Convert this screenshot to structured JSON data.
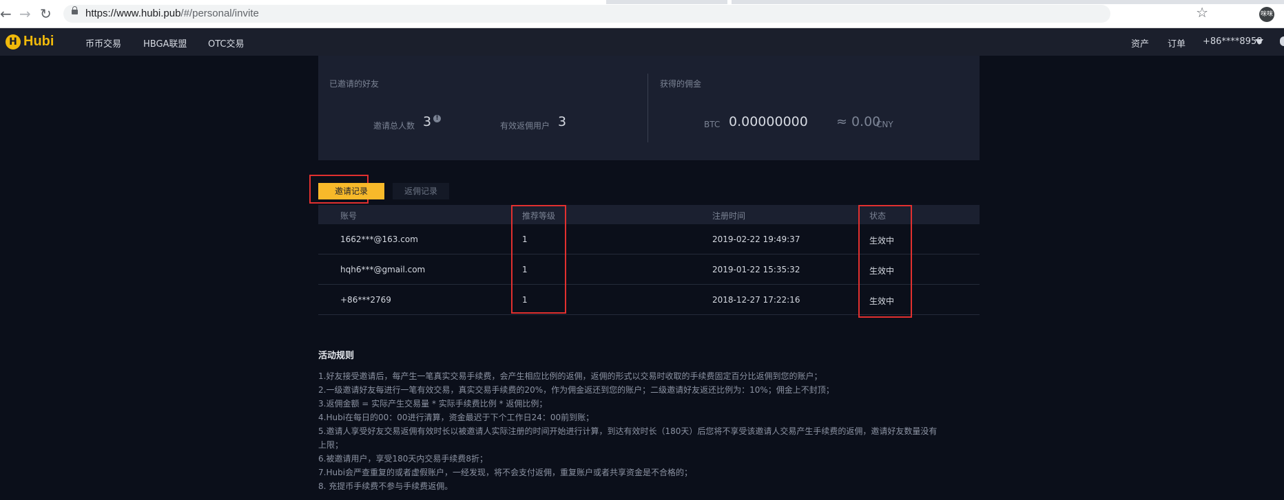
{
  "browser": {
    "url_host": "https://www.hubi.pub",
    "url_path": "/#/personal/invite",
    "profile_label": "咪咪"
  },
  "header": {
    "logo_mark": "H",
    "logo_text": "Hubi",
    "nav": [
      "币币交易",
      "HBGA联盟",
      "OTC交易"
    ],
    "right": [
      "资产",
      "订单",
      "+86****8958"
    ]
  },
  "stats": {
    "invited_title": "已邀请的好友",
    "total_label": "邀请总人数",
    "total_value": "3",
    "info_glyph": "!",
    "valid_label": "有效返佣用户",
    "valid_value": "3",
    "commission_title": "获得的佣金",
    "btc_label": "BTC",
    "btc_value": "0.00000000",
    "cny_value": "≈ 0.00",
    "cny_label": "CNY"
  },
  "tabs": {
    "active": "邀请记录",
    "inactive": "返佣记录"
  },
  "table": {
    "headers": [
      "账号",
      "推荐等级",
      "注册时间",
      "状态"
    ],
    "rows": [
      {
        "account": "1662***@163.com",
        "level": "1",
        "time": "2019-02-22 19:49:37",
        "status": "生效中"
      },
      {
        "account": "hqh6***@gmail.com",
        "level": "1",
        "time": "2019-01-22 15:35:32",
        "status": "生效中"
      },
      {
        "account": "+86***2769",
        "level": "1",
        "time": "2018-12-27 17:22:16",
        "status": "生效中"
      }
    ]
  },
  "rules": {
    "title": "活动规则",
    "lines": [
      "1.好友接受邀请后，每产生一笔真实交易手续费，会产生相应比例的返佣，返佣的形式以交易时收取的手续费固定百分比返佣到您的账户；",
      "2.一级邀请好友每进行一笔有效交易，真实交易手续费的20%，作为佣金返还到您的账户；二级邀请好友返还比例为：10%；佣金上不封顶；",
      "3.返佣金额 = 实际产生交易量 * 实际手续费比例 * 返佣比例；",
      "4.Hubi在每日的00：00进行清算，资金最迟于下个工作日24：00前到账；",
      "5.邀请人享受好友交易返佣有效时长以被邀请人实际注册的时间开始进行计算，到达有效时长（180天）后您将不享受该邀请人交易产生手续费的返佣，邀请好友数量没有",
      "上限；",
      "6.被邀请用户，享受180天内交易手续费8折；",
      "7.Hubi会严查重复的或者虚假账户，一经发现，将不会支付返佣，重复账户或者共享资金是不合格的；",
      "8. 充提币手续费不参与手续费返佣。"
    ]
  },
  "colors": {
    "accent": "#f7b92a",
    "highlight_box": "#e2302f",
    "background": "#0b0f1a",
    "panel": "#1b2030"
  }
}
